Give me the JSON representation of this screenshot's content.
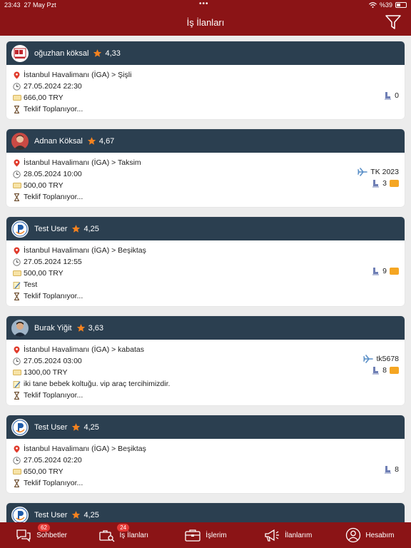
{
  "status": {
    "time": "23:43",
    "date": "27 May Pzt",
    "battery": "%39"
  },
  "header": {
    "title": "İş İlanları"
  },
  "status_label": "Teklif Toplanıyor...",
  "cards": [
    {
      "user": "oğuzhan köksal",
      "rating": "4,33",
      "route": "İstanbul Havalimanı (İGA) > Şişli",
      "datetime": "27.05.2024 22:30",
      "price": "666,00 TRY",
      "seats": "0"
    },
    {
      "user": "Adnan Köksal",
      "rating": "4,67",
      "route": "İstanbul Havalimanı (İGA) > Taksim",
      "datetime": "28.05.2024 10:00",
      "price": "500,00 TRY",
      "flight": "TK 2023",
      "seats": "3"
    },
    {
      "user": "Test User",
      "rating": "4,25",
      "route": "İstanbul Havalimanı (İGA) > Beşiktaş",
      "datetime": "27.05.2024 12:55",
      "price": "500,00 TRY",
      "note": "Test",
      "seats": "9"
    },
    {
      "user": "Burak Yiğit",
      "rating": "3,63",
      "route": "İstanbul Havalimanı (İGA) > kabatas",
      "datetime": "27.05.2024 03:00",
      "price": "1300,00 TRY",
      "note": "iki tane bebek koltuğu. vip araç tercihimizdir.",
      "flight": "tk5678",
      "seats": "8"
    },
    {
      "user": "Test User",
      "rating": "4,25",
      "route": "İstanbul Havalimanı (İGA) > Beşiktaş",
      "datetime": "27.05.2024 02:20",
      "price": "650,00 TRY",
      "seats": "8"
    },
    {
      "user": "Test User",
      "rating": "4,25"
    }
  ],
  "tabs": [
    {
      "label": "Sohbetler",
      "badge": "62",
      "icon": "chat-icon"
    },
    {
      "label": "İş İlanları",
      "badge": "24",
      "icon": "job-search-icon"
    },
    {
      "label": "İşlerim",
      "icon": "briefcase-icon"
    },
    {
      "label": "İlanlarım",
      "icon": "megaphone-icon"
    },
    {
      "label": "Hesabım",
      "icon": "account-icon"
    }
  ],
  "colors": {
    "brand": "#8b1416",
    "card_header": "#2b3f50",
    "star": "#f5821f"
  }
}
